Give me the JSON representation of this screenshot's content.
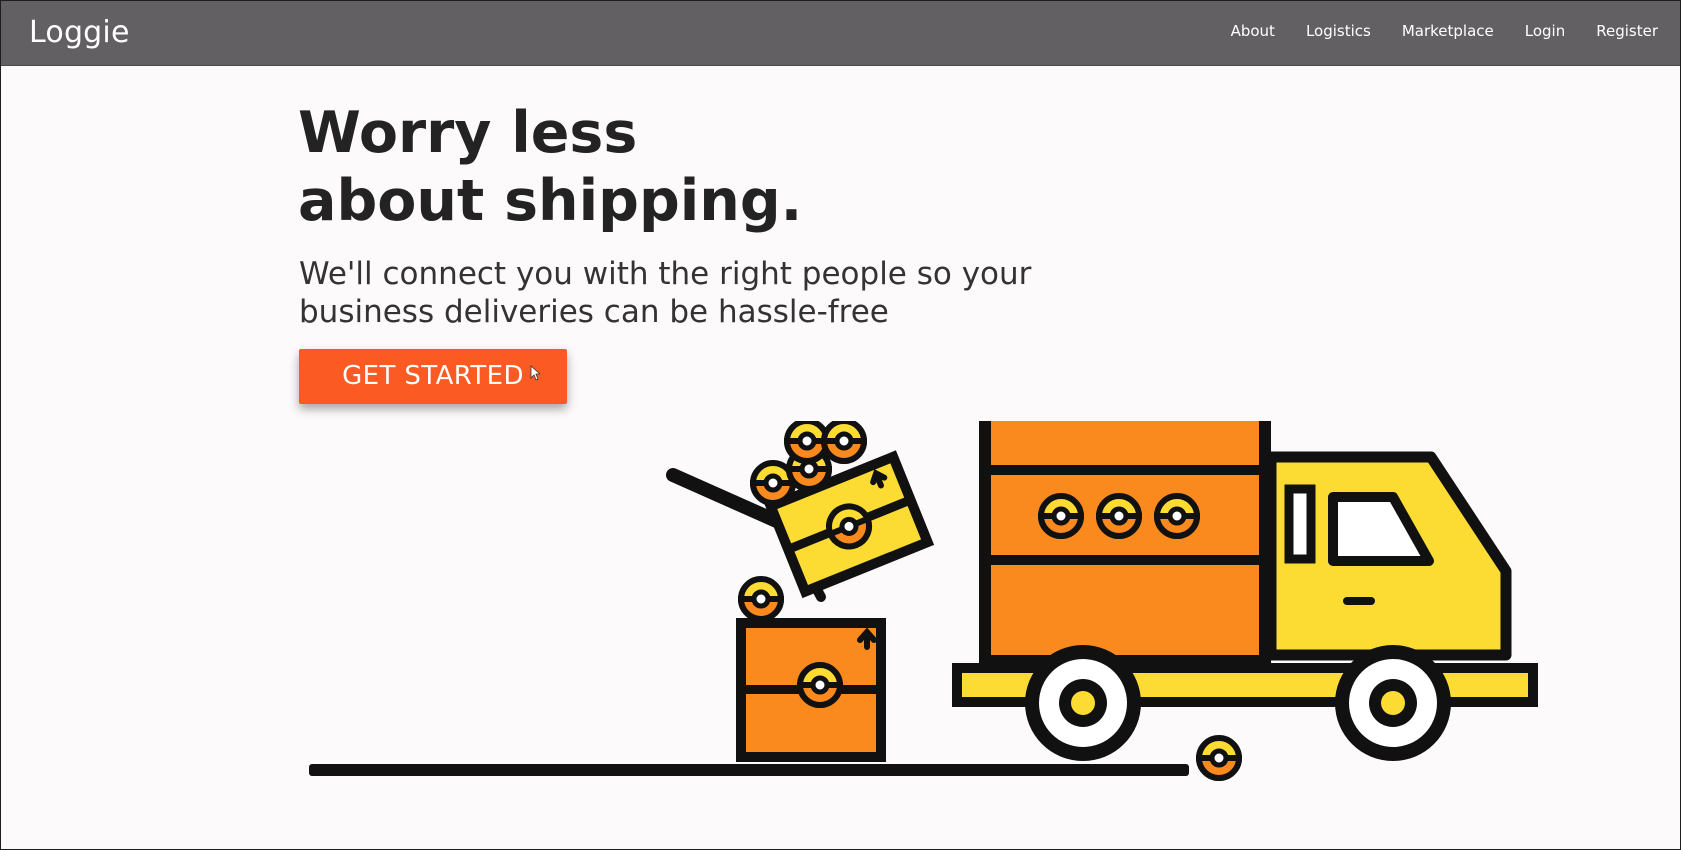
{
  "navbar": {
    "brand": "Loggie",
    "links": [
      {
        "label": "About"
      },
      {
        "label": "Logistics"
      },
      {
        "label": "Marketplace"
      },
      {
        "label": "Login"
      },
      {
        "label": "Register"
      }
    ],
    "background_color": "#626063"
  },
  "hero": {
    "title_line_1": "Worry less",
    "title_line_2": "about shipping.",
    "subtitle_line_1": "We'll connect you with the right people so your",
    "subtitle_line_2": "business deliveries can be hassle-free",
    "cta_label": "GET STARTED",
    "cta_color": "#fb5a22"
  },
  "illustration": {
    "subject": "delivery truck being loaded with packages",
    "colors": {
      "orange": "#fb8a1e",
      "yellow": "#fcdb33",
      "outline": "#111111"
    }
  }
}
